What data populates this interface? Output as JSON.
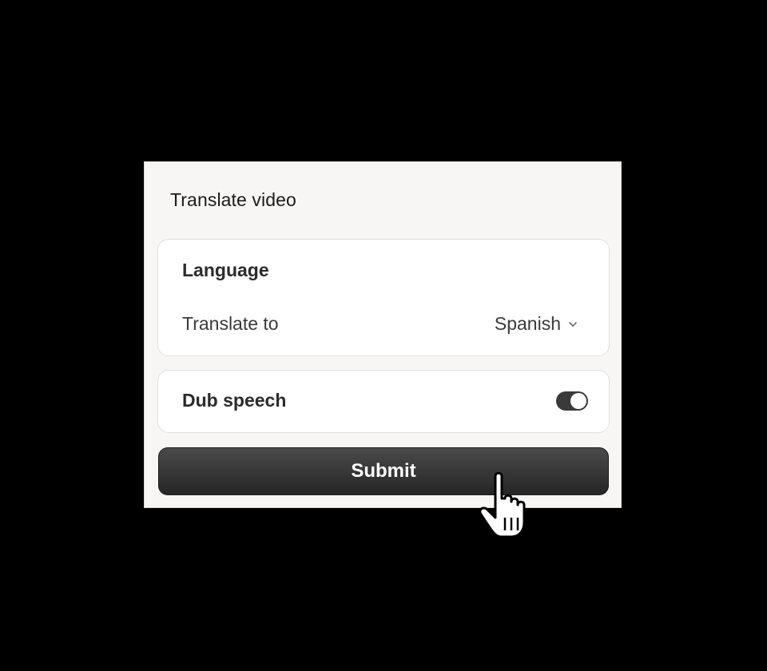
{
  "dialog": {
    "title": "Translate video"
  },
  "language_card": {
    "heading": "Language",
    "translate_label": "Translate to",
    "selected_language": "Spanish"
  },
  "dub_card": {
    "label": "Dub speech",
    "enabled": true
  },
  "submit": {
    "label": "Submit"
  },
  "icons": {
    "dropdown": "chevron-down-icon",
    "pointer": "hand-pointer-icon"
  },
  "colors": {
    "background": "#000000",
    "dialog_bg": "#f7f6f4",
    "card_bg": "#ffffff",
    "button_bg": "#2f2f2f",
    "toggle_on": "#3a3a3a"
  }
}
